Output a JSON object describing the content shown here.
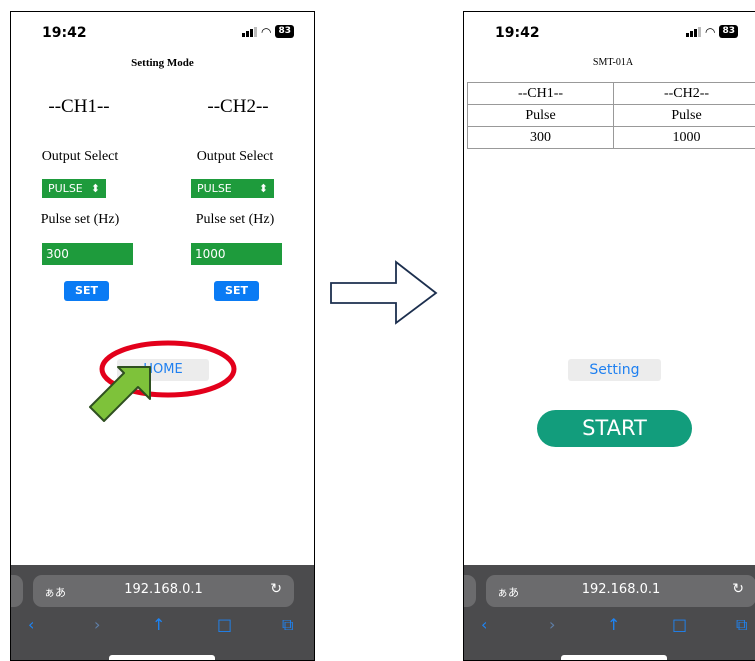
{
  "left": {
    "status": {
      "time": "19:42",
      "battery": "83"
    },
    "title": "Setting Mode",
    "ch1": {
      "header": "--CH1--",
      "output_label": "Output Select",
      "output_value": "PULSE",
      "pulse_label": "Pulse set (Hz)",
      "pulse_value": "300",
      "set_label": "SET"
    },
    "ch2": {
      "header": "--CH2--",
      "output_label": "Output Select",
      "output_value": "PULSE",
      "pulse_label": "Pulse set (Hz)",
      "pulse_value": "1000",
      "set_label": "SET"
    },
    "home_label": "HOME",
    "browser": {
      "aa": "ぁあ",
      "address": "192.168.0.1"
    }
  },
  "right": {
    "status": {
      "time": "19:42",
      "battery": "83"
    },
    "title": "SMT-01A",
    "table": {
      "headers": [
        "--CH1--",
        "--CH2--"
      ],
      "rows": [
        [
          "Pulse",
          "Pulse"
        ],
        [
          "300",
          "1000"
        ]
      ]
    },
    "setting_label": "Setting",
    "start_label": "START",
    "browser": {
      "aa": "ぁあ",
      "address": "192.168.0.1"
    }
  },
  "colors": {
    "green": "#1e9b3c",
    "blue": "#0a7bf4",
    "teal": "#129d7c",
    "highlight_red": "#e3001b",
    "arrow_green": "#7ec23a"
  }
}
